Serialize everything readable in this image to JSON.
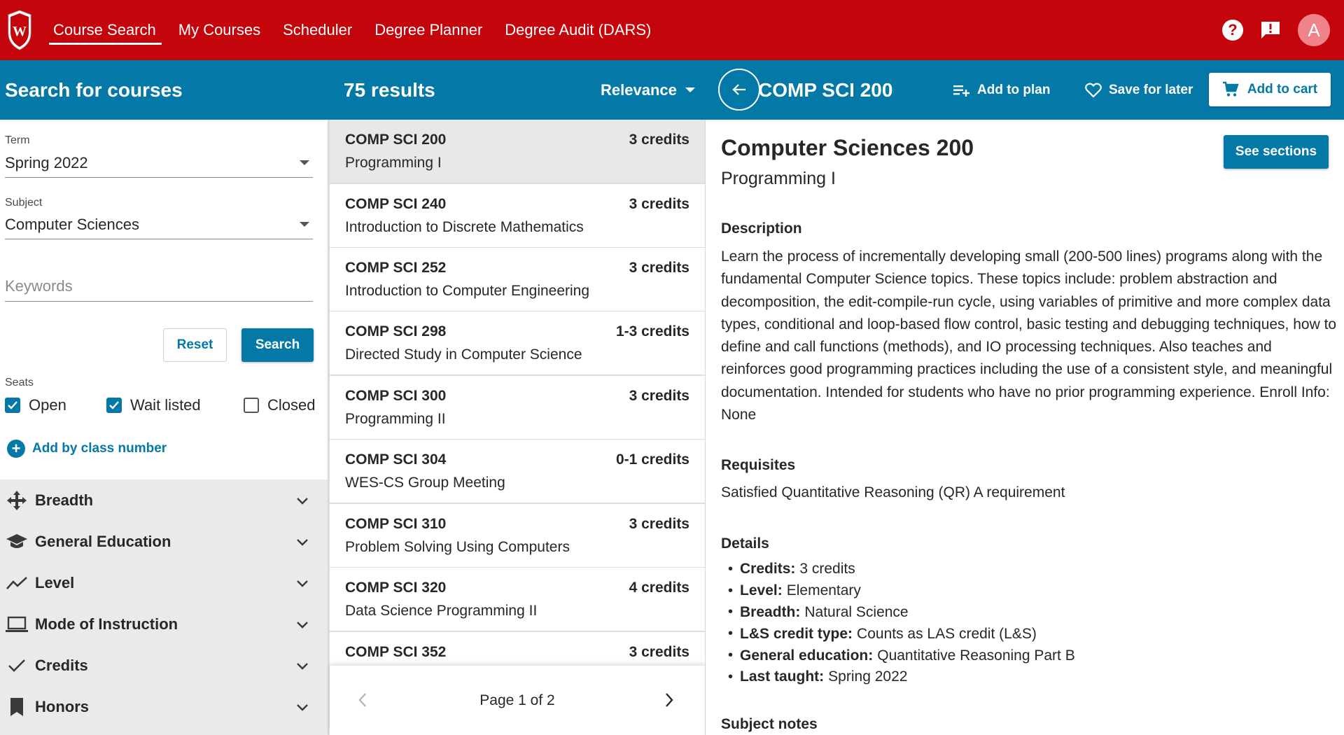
{
  "nav": {
    "links": [
      "Course Search",
      "My Courses",
      "Scheduler",
      "Degree Planner",
      "Degree Audit (DARS)"
    ],
    "active": "Course Search",
    "avatar_letter": "A",
    "help_label": "?"
  },
  "bluebar": {
    "search_title": "Search for courses",
    "results_count": "75 results",
    "sort_label": "Relevance",
    "course_code": "COMP SCI 200",
    "add_to_plan": "Add to plan",
    "save_for_later": "Save for later",
    "add_to_cart": "Add to cart"
  },
  "filters": {
    "term_label": "Term",
    "term_value": "Spring 2022",
    "subject_label": "Subject",
    "subject_value": "Computer Sciences",
    "keywords_placeholder": "Keywords",
    "reset_label": "Reset",
    "search_label": "Search",
    "seats_label": "Seats",
    "seats": [
      {
        "label": "Open",
        "checked": true
      },
      {
        "label": "Wait listed",
        "checked": true
      },
      {
        "label": "Closed",
        "checked": false
      }
    ],
    "add_by_class_number": "Add by class number",
    "accordion": [
      {
        "label": "Breadth",
        "icon": "breadth-arrows-icon"
      },
      {
        "label": "General Education",
        "icon": "graduation-cap-icon"
      },
      {
        "label": "Level",
        "icon": "trending-line-icon"
      },
      {
        "label": "Mode of Instruction",
        "icon": "laptop-icon"
      },
      {
        "label": "Credits",
        "icon": "check-icon"
      },
      {
        "label": "Honors",
        "icon": "bookmark-icon"
      }
    ]
  },
  "results": [
    {
      "code": "COMP SCI 200",
      "credits": "3 credits",
      "title": "Programming I"
    },
    {
      "code": "COMP SCI 240",
      "credits": "3 credits",
      "title": "Introduction to Discrete Mathematics"
    },
    {
      "code": "COMP SCI 252",
      "credits": "3 credits",
      "title": "Introduction to Computer Engineering"
    },
    {
      "code": "COMP SCI 298",
      "credits": "1-3 credits",
      "title": "Directed Study in Computer Science"
    },
    {
      "code": "COMP SCI 300",
      "credits": "3 credits",
      "title": "Programming II"
    },
    {
      "code": "COMP SCI 304",
      "credits": "0-1 credits",
      "title": "WES-CS Group Meeting"
    },
    {
      "code": "COMP SCI 310",
      "credits": "3 credits",
      "title": "Problem Solving Using Computers"
    },
    {
      "code": "COMP SCI 320",
      "credits": "4 credits",
      "title": "Data Science Programming II"
    },
    {
      "code": "COMP SCI 352",
      "credits": "3 credits",
      "title": ""
    }
  ],
  "pager": {
    "text": "Page 1 of 2"
  },
  "detail": {
    "title": "Computer Sciences 200",
    "subtitle": "Programming I",
    "see_sections": "See sections",
    "description_heading": "Description",
    "description": "Learn the process of incrementally developing small (200-500 lines) programs along with the fundamental Computer Science topics. These topics include: problem abstraction and decomposition, the edit-compile-run cycle, using variables of primitive and more complex data types, conditional and loop-based flow control, basic testing and debugging techniques, how to define and call functions (methods), and IO processing techniques. Also teaches and reinforces good programming practices including the use of a consistent style, and meaningful documentation. Intended for students who have no prior programming experience. Enroll Info: None",
    "requisites_heading": "Requisites",
    "requisites": "Satisfied Quantitative Reasoning (QR) A requirement",
    "details_heading": "Details",
    "details": [
      {
        "key": "Credits:",
        "value": "3 credits"
      },
      {
        "key": "Level:",
        "value": "Elementary"
      },
      {
        "key": "Breadth:",
        "value": "Natural Science"
      },
      {
        "key": "L&S credit type:",
        "value": "Counts as LAS credit (L&S)"
      },
      {
        "key": "General education:",
        "value": "Quantitative Reasoning Part B"
      },
      {
        "key": "Last taught:",
        "value": "Spring 2022"
      }
    ],
    "subject_notes_heading": "Subject notes"
  },
  "colors": {
    "red": "#c5050c",
    "blue": "#0479a8"
  }
}
